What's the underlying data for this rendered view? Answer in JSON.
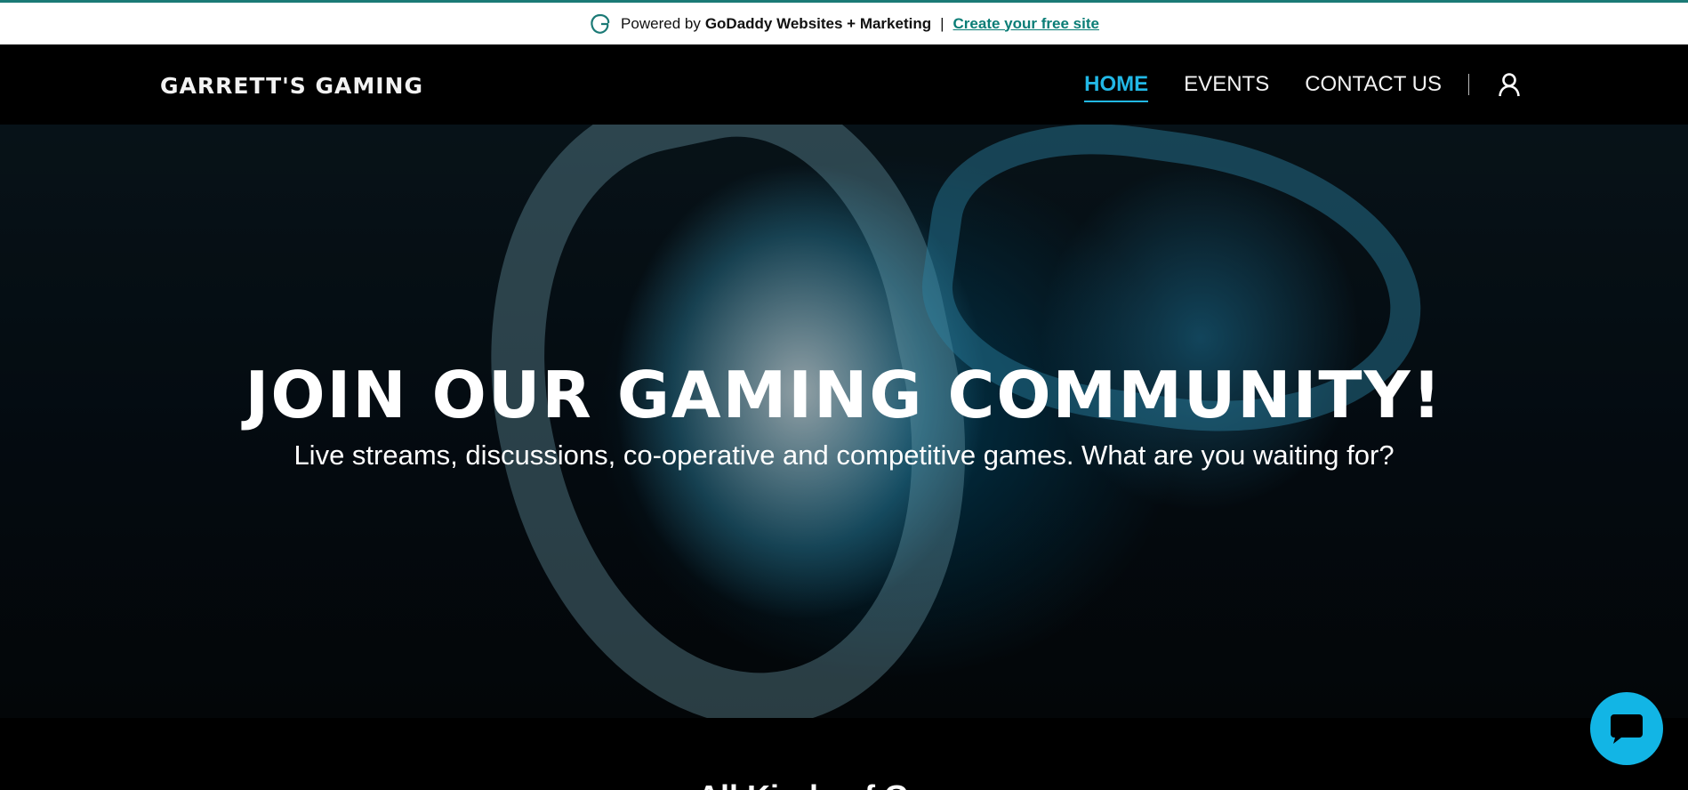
{
  "promo": {
    "powered_prefix": "Powered by",
    "powered_brand": "GoDaddy Websites + Marketing",
    "separator": "|",
    "cta": "Create your free site"
  },
  "header": {
    "site_title": "GARRETT'S GAMING",
    "nav": [
      {
        "label": "HOME",
        "active": true
      },
      {
        "label": "EVENTS",
        "active": false
      },
      {
        "label": "CONTACT US",
        "active": false
      }
    ],
    "divider": "|",
    "account_icon": "user-icon"
  },
  "hero": {
    "title": "JOIN OUR GAMING COMMUNITY!",
    "subtitle": "Live streams, discussions, co-operative and competitive games. What are you waiting for?"
  },
  "section": {
    "heading": "All Kinds of Games"
  },
  "chat": {
    "icon": "chat-bubble-icon"
  },
  "colors": {
    "accent": "#22b8e6",
    "chat": "#12b5e5",
    "promo_link": "#0a7d76",
    "background": "#000000"
  }
}
